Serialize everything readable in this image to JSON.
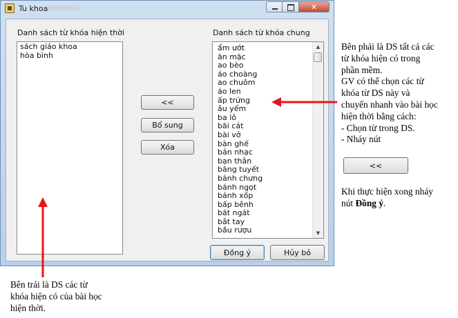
{
  "window": {
    "title": "Tu khoa",
    "controls": {
      "minimize_icon": "minimize-icon",
      "maximize_icon": "maximize-icon",
      "close_label": "✕"
    }
  },
  "left_panel": {
    "label": "Danh sách từ khóa hiện thời",
    "items": [
      "sách giáo khoa",
      "hòa bình"
    ]
  },
  "right_panel": {
    "label": "Danh sách từ khóa chung",
    "items": [
      "ẩm ướt",
      "ăn mặc",
      "ao bèo",
      "áo choàng",
      "ao chuôm",
      "áo len",
      "ấp trứng",
      "âu yếm",
      "ba lô",
      "bãi cát",
      "bài vở",
      "bàn ghế",
      "bản nhạc",
      "bạn thân",
      "băng tuyết",
      "bánh chưng",
      "bánh ngọt",
      "bánh xốp",
      "bấp bênh",
      "bát ngát",
      "bắt tay",
      "bầu rượu"
    ]
  },
  "buttons": {
    "move_left": "<<",
    "add": "Bổ sung",
    "delete": "Xóa",
    "ok": "Đồng ý",
    "cancel": "Hủy bỏ"
  },
  "annotations": {
    "right_note": [
      "Bên phải là DS tất cả các",
      "từ khóa hiện có trong",
      "phần mềm.",
      "GV có thể chọn các từ",
      "khóa từ DS này và",
      "chuyển nhanh vào bài học",
      "hiện thời bằng cách:",
      "- Chọn từ trong DS.",
      "- Nháy nút"
    ],
    "sample_button": "<<",
    "finish_note_prefix": "Khi thực hiện xong nháy",
    "finish_note_mid": "nút ",
    "finish_note_bold": "Đồng ý",
    "finish_note_suffix": ".",
    "left_note": [
      "Bên trái là DS các từ",
      "khóa hiện có của bài học",
      "hiện thời."
    ],
    "arrow_color": "#e8141c"
  }
}
